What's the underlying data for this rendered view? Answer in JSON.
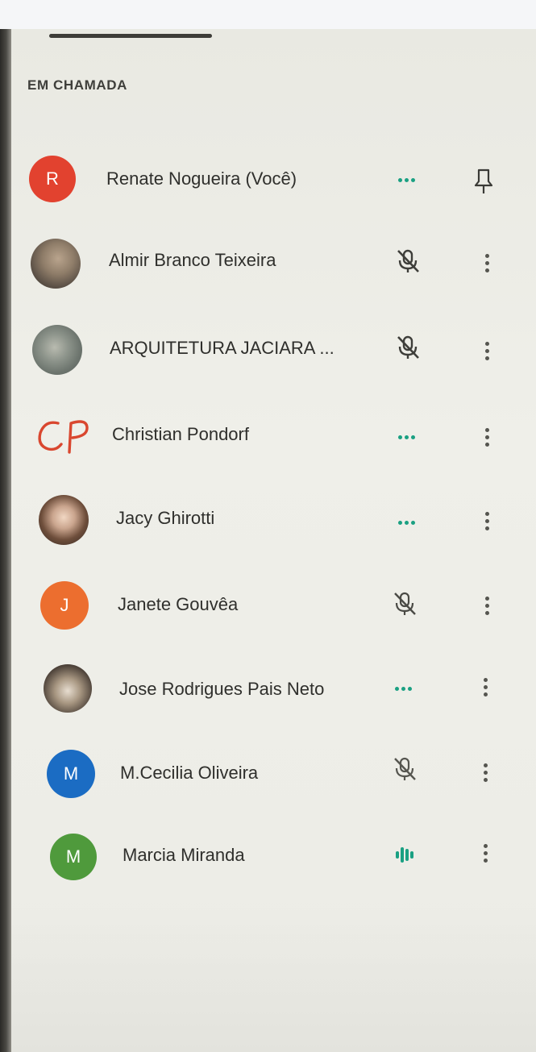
{
  "panel": {
    "section_label": "EM CHAMADA"
  },
  "participants": [
    {
      "name": "Renate Nogueira (Você)",
      "avatar_type": "initial",
      "initial": "R",
      "avatar_color": "#e2422f",
      "status": "speaking-dots",
      "action": "pin"
    },
    {
      "name": "Almir Branco Teixeira",
      "avatar_type": "photo",
      "status": "muted",
      "action": "more"
    },
    {
      "name": "ARQUITETURA JACIARA ...",
      "avatar_type": "photo",
      "status": "muted",
      "action": "more"
    },
    {
      "name": "Christian Pondorf",
      "avatar_type": "handwritten",
      "initial": "CP",
      "avatar_color": "#d9472f",
      "status": "speaking-dots",
      "action": "more"
    },
    {
      "name": "Jacy Ghirotti",
      "avatar_type": "photo",
      "status": "speaking-dots",
      "action": "more"
    },
    {
      "name": "Janete Gouvêa",
      "avatar_type": "initial",
      "initial": "J",
      "avatar_color": "#ec6e2f",
      "status": "muted",
      "action": "more"
    },
    {
      "name": "Jose Rodrigues Pais Neto",
      "avatar_type": "photo",
      "status": "speaking-dots",
      "action": "more"
    },
    {
      "name": "M.Cecilia Oliveira",
      "avatar_type": "initial",
      "initial": "M",
      "avatar_color": "#1b6cc3",
      "status": "muted",
      "action": "more"
    },
    {
      "name": "Marcia Miranda",
      "avatar_type": "initial",
      "initial": "M",
      "avatar_color": "#4f9a3c",
      "status": "talking-bars",
      "action": "more"
    }
  ],
  "colors": {
    "accent": "#1aa082",
    "text": "#2f2f2c",
    "panel_bg": "#ececE6"
  }
}
